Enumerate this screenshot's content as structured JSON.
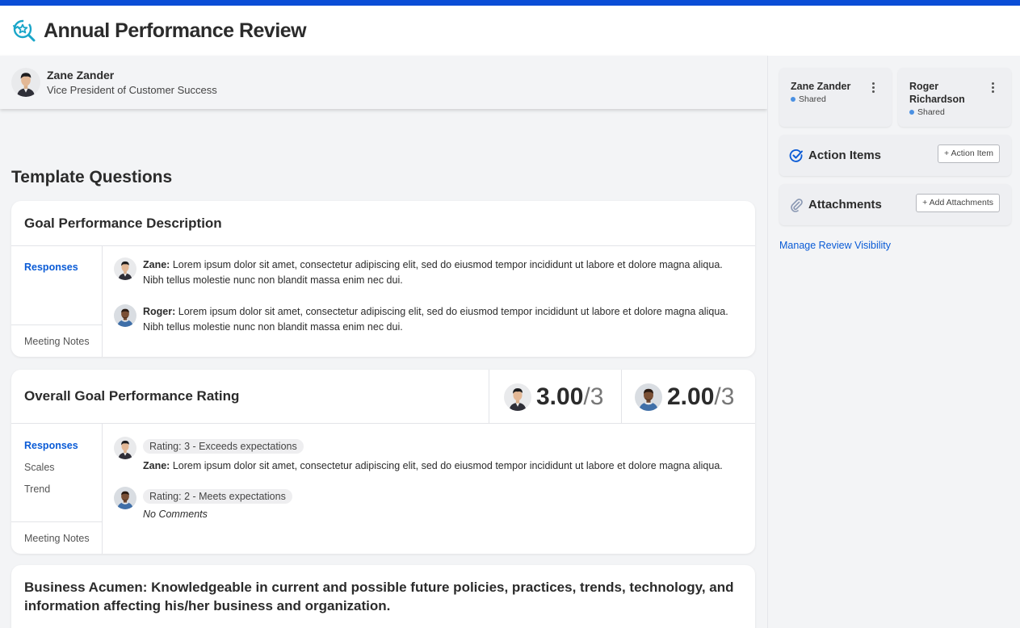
{
  "header": {
    "title": "Annual Performance Review",
    "logo_icon": "star-magnifier-icon"
  },
  "employee": {
    "name": "Zane Zander",
    "title": "Vice President of Customer Success"
  },
  "section_title": "Template Questions",
  "questions": [
    {
      "title": "Goal Performance Description",
      "tabs": [
        "Responses"
      ],
      "notes_tab": "Meeting Notes",
      "responses": [
        {
          "author": "Zane:",
          "text": "Lorem ipsum dolor sit amet, consectetur adipiscing elit, sed do eiusmod tempor incididunt ut labore et dolore magna aliqua. Nibh tellus molestie nunc non blandit massa enim nec dui."
        },
        {
          "author": "Roger:",
          "text": "Lorem ipsum dolor sit amet, consectetur adipiscing elit, sed do eiusmod tempor incididunt ut labore et dolore magna aliqua. Nibh tellus molestie nunc non blandit massa enim nec dui."
        }
      ]
    },
    {
      "title": "Overall Goal Performance Rating",
      "scores": [
        {
          "value": "3.00",
          "max": "/3"
        },
        {
          "value": "2.00",
          "max": "/3"
        }
      ],
      "tabs": [
        "Responses",
        "Scales",
        "Trend"
      ],
      "notes_tab": "Meeting Notes",
      "responses": [
        {
          "rating": "Rating: 3 - Exceeds expectations",
          "author": "Zane:",
          "text": "Lorem ipsum dolor sit amet, consectetur adipiscing elit, sed do eiusmod tempor incididunt ut labore et dolore magna aliqua."
        },
        {
          "rating": "Rating: 2 - Meets expectations",
          "comment": "No Comments"
        }
      ]
    },
    {
      "title": "Business Acumen: Knowledgeable in current and possible future policies, practices, trends, technology, and information affecting his/her business and organization."
    }
  ],
  "sidebar": {
    "reviewers": [
      {
        "name": "Zane Zander",
        "status": "Shared"
      },
      {
        "name": "Roger Richardson",
        "status": "Shared"
      }
    ],
    "action_items": {
      "title": "Action Items",
      "button": "+ Action Item"
    },
    "attachments": {
      "title": "Attachments",
      "button": "+ Add Attachments"
    },
    "manage_link": "Manage Review Visibility"
  },
  "colors": {
    "top_bar": "#0a4dd6",
    "accent": "#0a5bd6",
    "logo": "#1aa6c9"
  }
}
